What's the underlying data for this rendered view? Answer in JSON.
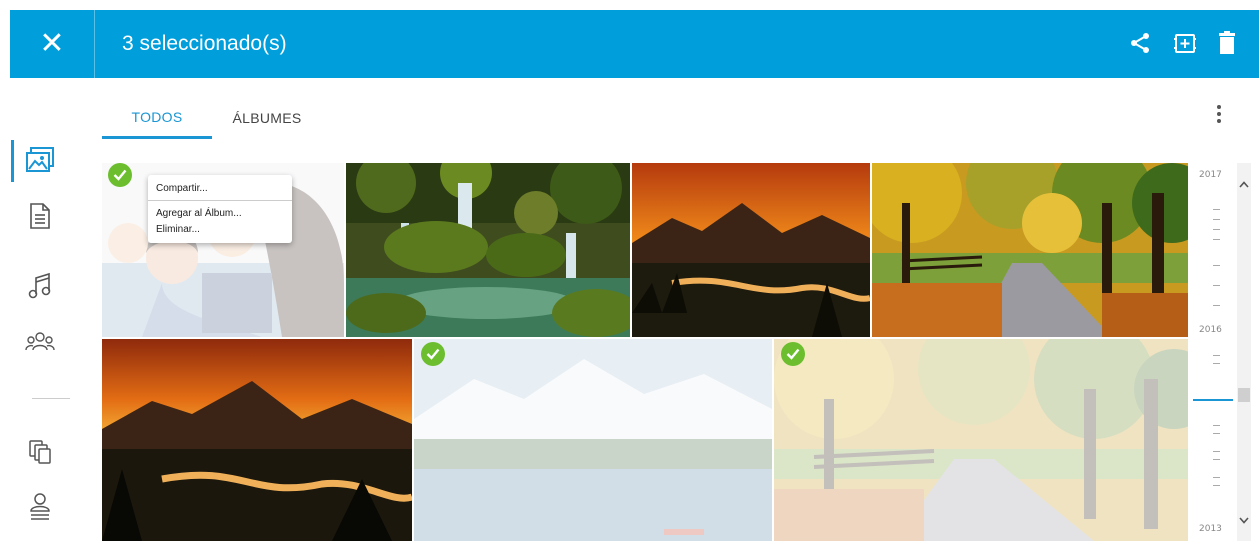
{
  "header": {
    "title": "3 seleccionado(s)",
    "close_icon": "✕",
    "actions": [
      "share-icon",
      "add-to-album-icon",
      "trash-icon"
    ],
    "background": "#009fdc"
  },
  "tabs": [
    {
      "label": "TODOS",
      "active": true
    },
    {
      "label": "ÁLBUMES",
      "active": false
    }
  ],
  "sidebar": {
    "items": [
      "photos-icon",
      "documents-icon",
      "music-icon",
      "people-icon",
      "copy-icon",
      "account-icon"
    ],
    "active": "photos-icon"
  },
  "context_menu": {
    "items": [
      "Compartir...",
      "Agregar al Álbum...",
      "Eliminar..."
    ]
  },
  "photos": [
    {
      "subject": "family",
      "selected": true
    },
    {
      "subject": "waterfall",
      "selected": false
    },
    {
      "subject": "mountain-sunset",
      "selected": false
    },
    {
      "subject": "autumn-road",
      "selected": false
    },
    {
      "subject": "mountain-sunset",
      "selected": false
    },
    {
      "subject": "lake-mountains",
      "selected": true
    },
    {
      "subject": "autumn-road",
      "selected": true
    }
  ],
  "timeline": {
    "labels": [
      "2017",
      "2016",
      "2013"
    ]
  },
  "colors": {
    "accent": "#1a96d4",
    "check": "#6cbe2f"
  }
}
